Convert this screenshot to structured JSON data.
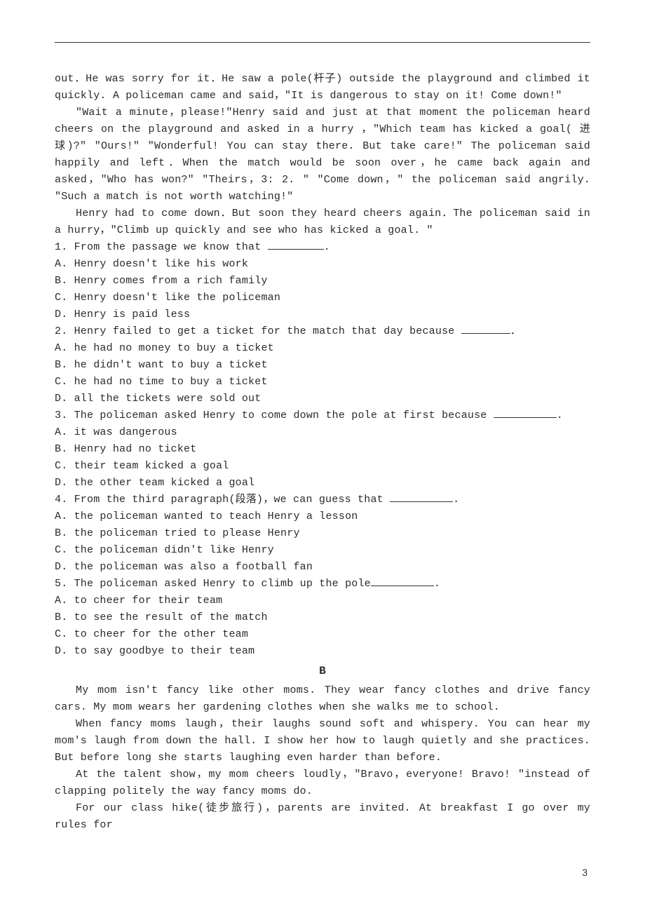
{
  "passage_a": {
    "p1": "out．He was sorry for it．He saw a pole(杆子) outside the playground and climbed it quickly. A policeman came and said，\"It is dangerous to stay on it! Come down!\"",
    "p2": "\"Wait a minute，please!\"Henry said and just at that moment the policeman heard cheers on the playground and asked in a hurry ，\"Which team has kicked a goal( 进球)?\" \"Ours!\" \"Wonderful! You can stay there. But take care!\" The policeman said happily and left．When the match would be soon over，he came back again and asked，\"Who has won?\" \"Theirs，3: 2. \" \"Come down，\" the policeman said angrily. \"Such a match is not worth watching!\"",
    "p3": "Henry had to come down．But soon they heard cheers again．The policeman said in a hurry，\"Climb up quickly and see who has kicked a goal. \""
  },
  "qa": {
    "q1": {
      "stem_pre": "1. From the passage we know that ",
      "stem_post": ".",
      "A": "A. Henry doesn't like his work",
      "B": "B. Henry comes from a rich family",
      "C": "C. Henry doesn't like the policeman",
      "D": "D. Henry is paid less"
    },
    "q2": {
      "stem_pre": "2. Henry failed to get a ticket for the match that day because ",
      "stem_post": "．",
      "A": "A. he had no money to buy a ticket",
      "B": "B. he didn't want to buy a ticket",
      "C": "C. he had no time to buy a ticket",
      "D": "D. all the tickets were sold out"
    },
    "q3": {
      "stem_pre": "3. The policeman asked Henry to come down the pole at first because ",
      "stem_post": ".",
      "A": "A. it was dangerous",
      "B": "B. Henry had no ticket",
      "C": "C. their team kicked a goal",
      "D": "D. the other team kicked a goal"
    },
    "q4": {
      "stem_pre": "4. From the third paragraph(段落)，we can guess that ",
      "stem_post": ".",
      "A": "A. the policeman wanted to teach Henry a lesson",
      "B": "B. the policeman tried to please Henry",
      "C": "C. the policeman didn't like Henry",
      "D": "D. the policeman was also a football fan"
    },
    "q5": {
      "stem_pre": "5. The policeman asked Henry to climb up the pole",
      "stem_post": ".",
      "A": "A. to cheer for their team",
      "B": "B. to see the result of the match",
      "C": "C. to cheer for the other team",
      "D": "D. to say goodbye to their team"
    }
  },
  "section_b_label": "B",
  "passage_b": {
    "p1": "My mom isn't fancy like other moms. They wear fancy clothes and drive fancy cars. My mom wears her gardening clothes when she walks me to school.",
    "p2": "When fancy moms laugh，their laughs sound soft and whispery. You can hear my mom's laugh from down the hall. I show her how to laugh quietly and she practices. But before long she starts laughing even harder than before.",
    "p3": "At the talent show，my mom cheers loudly，\"Bravo，everyone! Bravo! \"instead of clapping politely the way fancy moms do.",
    "p4": "For our class hike(徒步旅行)，parents are invited. At breakfast I go over my rules for"
  },
  "page_number": "3"
}
